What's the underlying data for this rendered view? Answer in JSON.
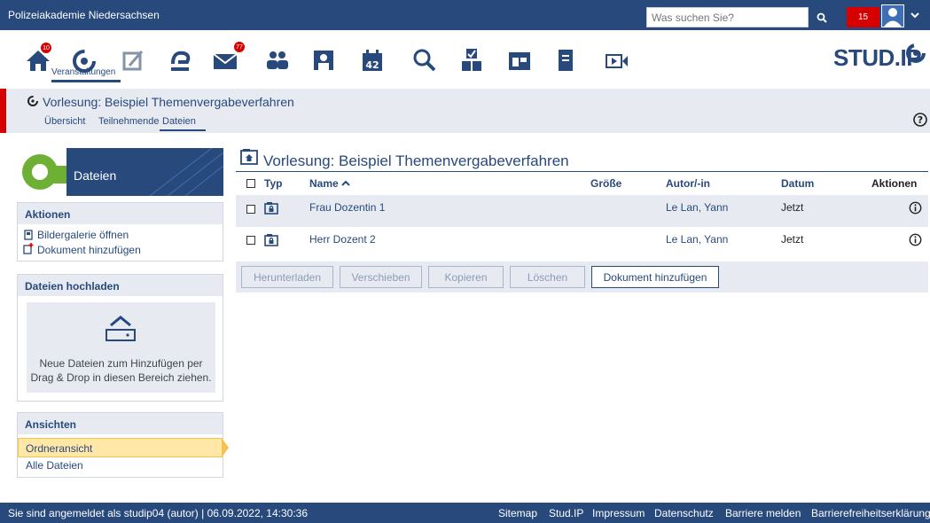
{
  "header": {
    "title": "Polizeiakademie Niedersachsen",
    "search_placeholder": "Was suchen Sie?",
    "notification_count": "15"
  },
  "nav": {
    "home_badge": "10",
    "messages_badge": "77",
    "active_label": "Veranstaltungen",
    "calendar_day": "42"
  },
  "brand": {
    "logo": "STUD.IP"
  },
  "context": {
    "title": "Vorlesung: Beispiel Themenvergabeverfahren",
    "tabs": [
      "Übersicht",
      "Teilnehmende",
      "Dateien"
    ]
  },
  "sidebar": {
    "header": "Dateien",
    "actions_title": "Aktionen",
    "actions": [
      "Bildergalerie öffnen",
      "Dokument hinzufügen"
    ],
    "upload_title": "Dateien hochladen",
    "upload_text_1": "Neue Dateien zum Hinzufügen per",
    "upload_text_2": "Drag & Drop in diesen Bereich ziehen.",
    "views_title": "Ansichten",
    "views": [
      "Ordneransicht",
      "Alle Dateien"
    ]
  },
  "main": {
    "title": "Vorlesung: Beispiel Themenvergabeverfahren",
    "columns": {
      "type": "Typ",
      "name": "Name",
      "size": "Größe",
      "author": "Autor/-in",
      "date": "Datum",
      "actions": "Aktionen"
    },
    "rows": [
      {
        "name": "Frau Dozentin 1",
        "size": "",
        "author": "Le Lan, Yann",
        "date": "Jetzt"
      },
      {
        "name": "Herr Dozent 2",
        "size": "",
        "author": "Le Lan, Yann",
        "date": "Jetzt"
      }
    ],
    "buttons": [
      "Herunterladen",
      "Verschieben",
      "Kopieren",
      "Löschen",
      "Dokument hinzufügen"
    ]
  },
  "footer": {
    "status": "Sie sind angemeldet als studip04 (autor) | 06.09.2022, 14:30:36",
    "links": [
      "Sitemap",
      "Stud.IP",
      "Impressum",
      "Datenschutz",
      "Barriere melden",
      "Barrierefreiheitserklärung"
    ]
  },
  "colors": {
    "brand": "#28497c",
    "alert": "#d60000",
    "shade": "#e7ebf1",
    "highlight": "#ffe7a8"
  }
}
